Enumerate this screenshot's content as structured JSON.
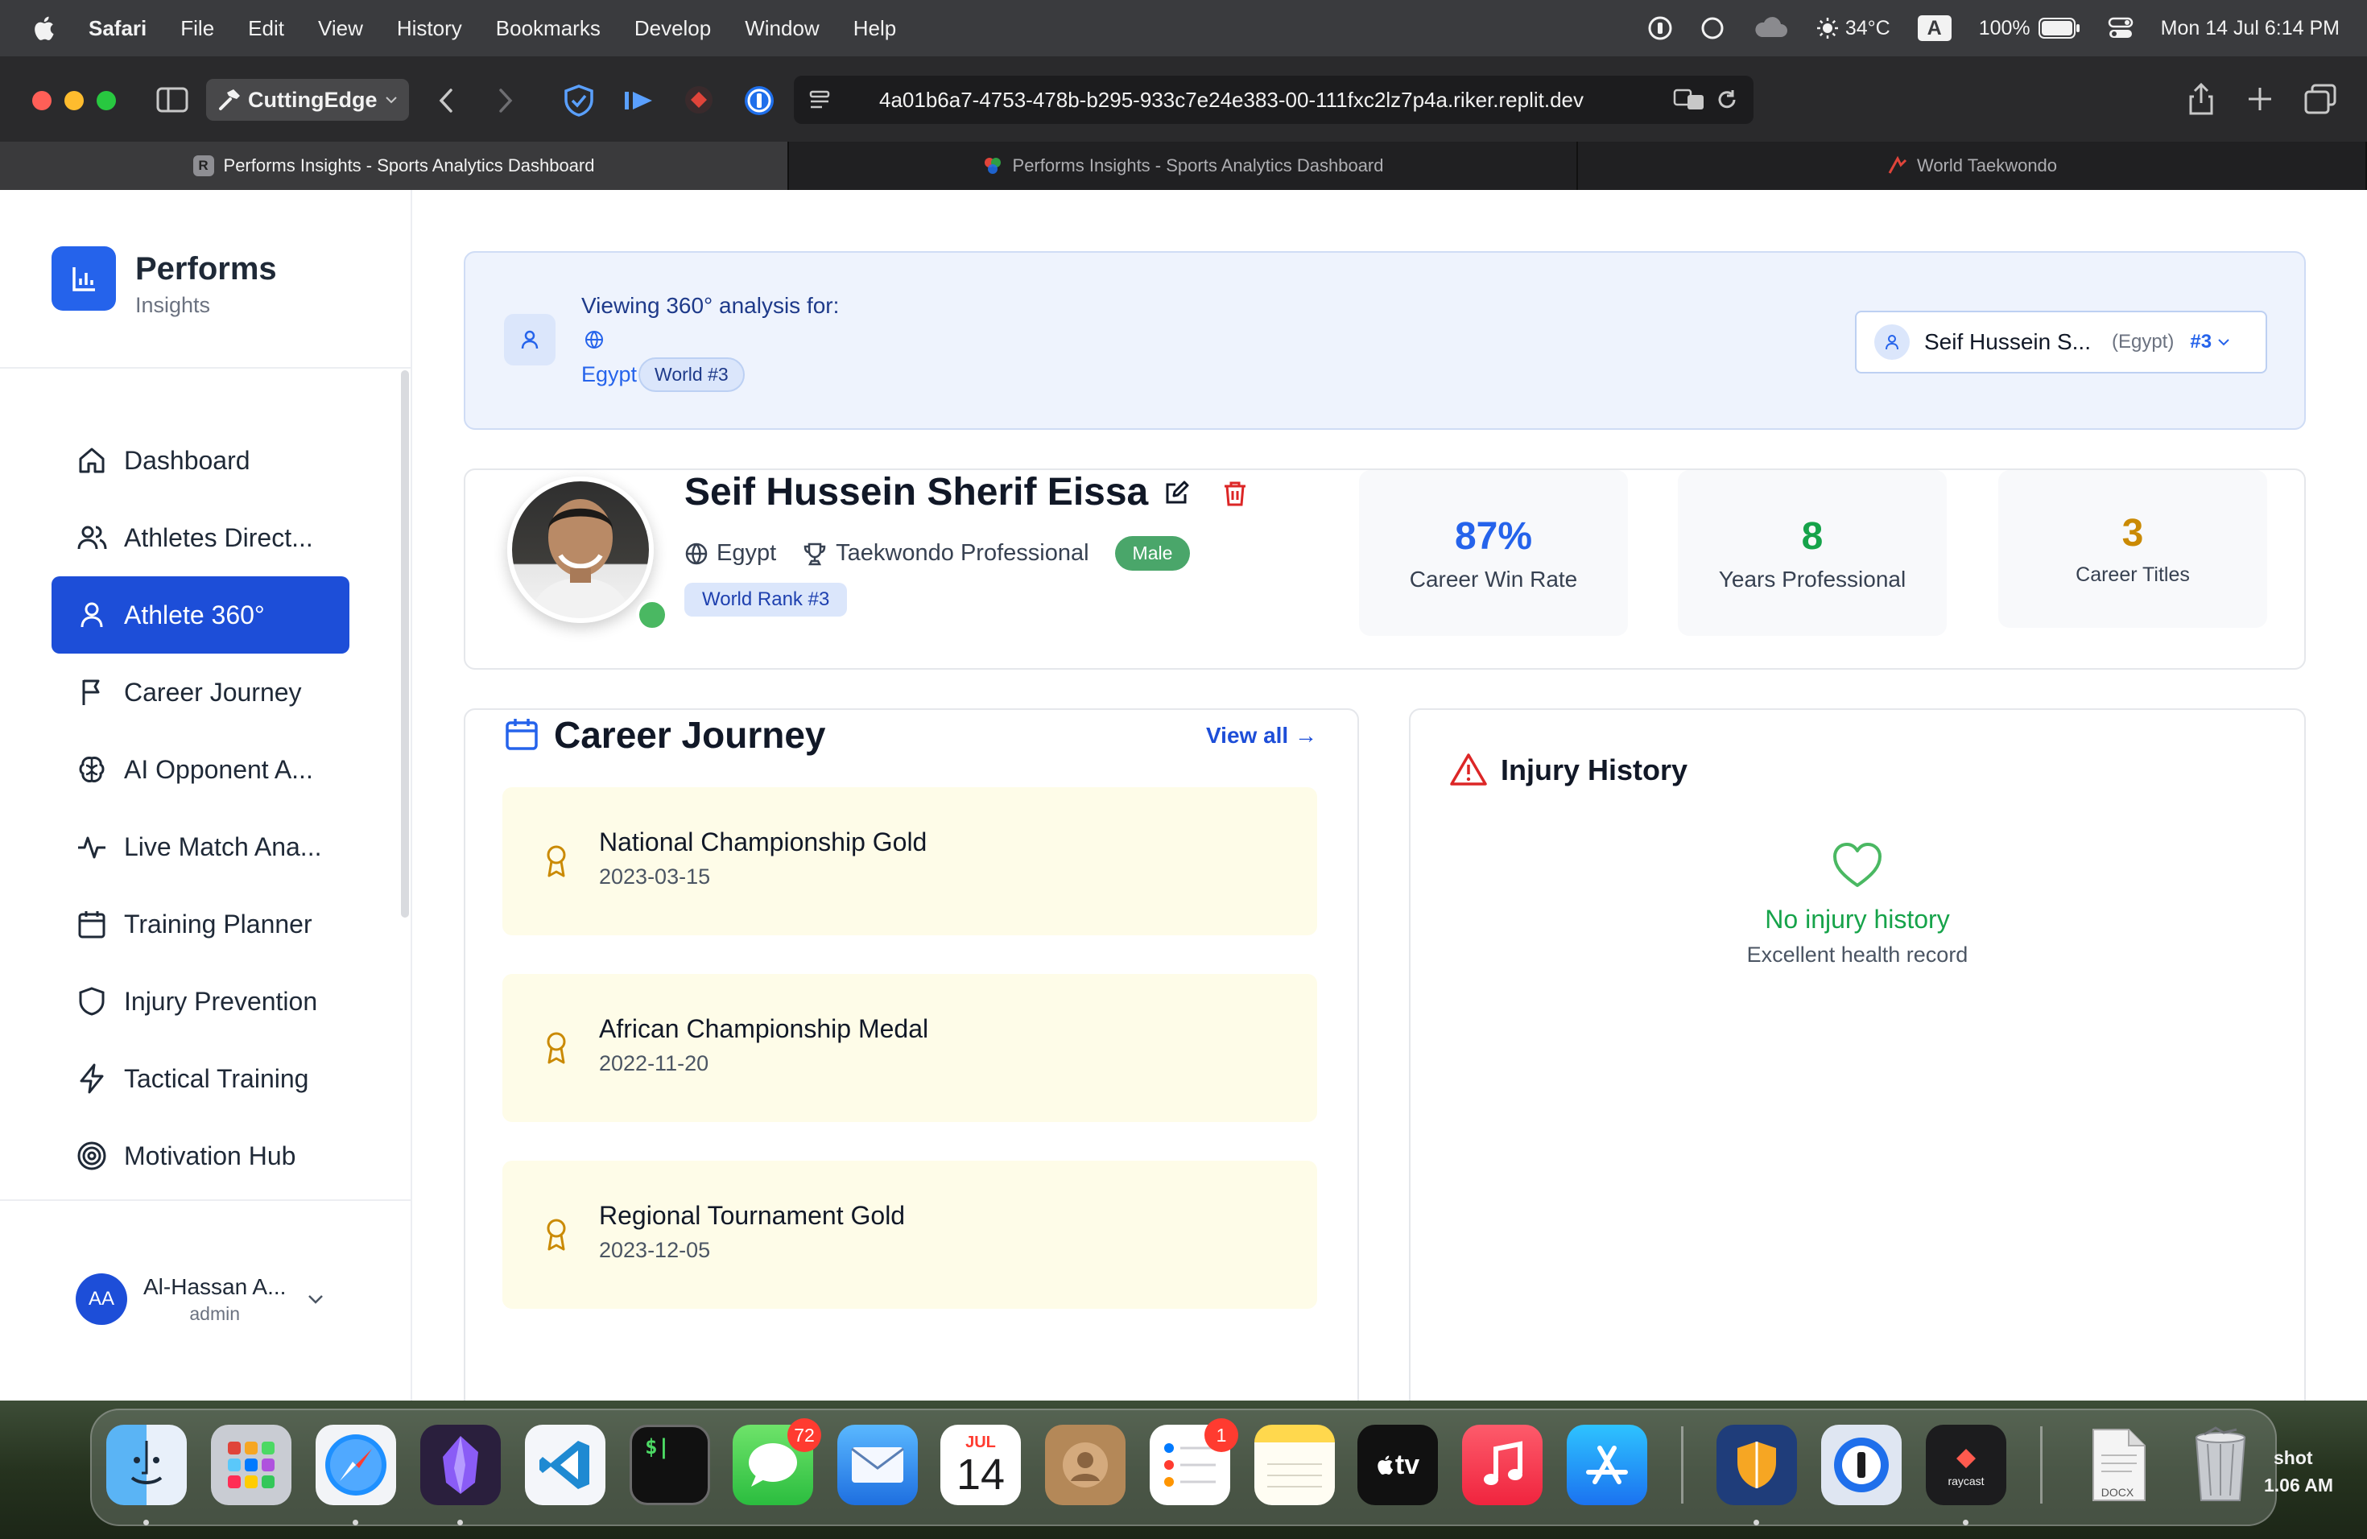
{
  "menubar": {
    "app": "Safari",
    "items": [
      "File",
      "Edit",
      "View",
      "History",
      "Bookmarks",
      "Develop",
      "Window",
      "Help"
    ],
    "temperature": "34°C",
    "input_source": "A",
    "battery": "100%",
    "datetime": "Mon 14 Jul  6:14 PM"
  },
  "browser": {
    "profile": "CuttingEdge",
    "url": "4a01b6a7-4753-478b-b295-933c7e24e383-00-111fxc2lz7p4a.riker.replit.dev",
    "tabs": [
      {
        "title": "Performs Insights - Sports Analytics Dashboard",
        "favicon": "R"
      },
      {
        "title": "Performs Insights - Sports Analytics Dashboard"
      },
      {
        "title": "World Taekwondo"
      }
    ]
  },
  "sidebar": {
    "brand_title": "Performs",
    "brand_subtitle": "Insights",
    "items": [
      {
        "label": "Dashboard",
        "icon": "home-icon"
      },
      {
        "label": "Athletes Direct...",
        "icon": "users-icon"
      },
      {
        "label": "Athlete 360°",
        "icon": "user-icon",
        "active": true
      },
      {
        "label": "Career Journey",
        "icon": "flag-icon"
      },
      {
        "label": "AI Opponent A...",
        "icon": "brain-icon"
      },
      {
        "label": "Live Match Ana...",
        "icon": "activity-icon"
      },
      {
        "label": "Training Planner",
        "icon": "calendar-icon"
      },
      {
        "label": "Injury Prevention",
        "icon": "shield-icon"
      },
      {
        "label": "Tactical Training",
        "icon": "zap-icon"
      },
      {
        "label": "Motivation Hub",
        "icon": "target-icon"
      }
    ],
    "user": {
      "initials": "AA",
      "name": "Al-Hassan A...",
      "role": "admin"
    }
  },
  "context": {
    "heading": "Viewing 360° analysis for:",
    "country": "Egypt",
    "rank_badge": "World #3",
    "selector": {
      "name": "Seif Hussein S...",
      "country": "(Egypt)",
      "rank": "#3"
    }
  },
  "athlete": {
    "name": "Seif Hussein Sherif Eissa",
    "country": "Egypt",
    "sport": "Taekwondo Professional",
    "gender": "Male",
    "world_rank": "World Rank #3",
    "online": true,
    "stats": [
      {
        "value": "87%",
        "label": "Career Win Rate",
        "color": "#2563eb"
      },
      {
        "value": "8",
        "label": "Years Professional",
        "color": "#16a34a"
      },
      {
        "value": "3",
        "label": "Career Titles",
        "color": "#ca8a04"
      }
    ]
  },
  "career": {
    "title": "Career Journey",
    "view_all": "View all →",
    "items": [
      {
        "title": "National Championship Gold",
        "date": "2023-03-15"
      },
      {
        "title": "African Championship Medal",
        "date": "2022-11-20"
      },
      {
        "title": "Regional Tournament Gold",
        "date": "2023-12-05"
      }
    ]
  },
  "injury": {
    "title": "Injury History",
    "empty_title": "No injury history",
    "empty_sub": "Excellent health record"
  },
  "dock": {
    "messages_badge": "72",
    "reminders_badge": "1",
    "calendar_month": "JUL",
    "calendar_day": "14",
    "tv_label": "tv",
    "raycast_label": "raycast",
    "file_label": "DOCX",
    "screenshot_label": "shot",
    "screenshot_time": "1.06 AM"
  }
}
